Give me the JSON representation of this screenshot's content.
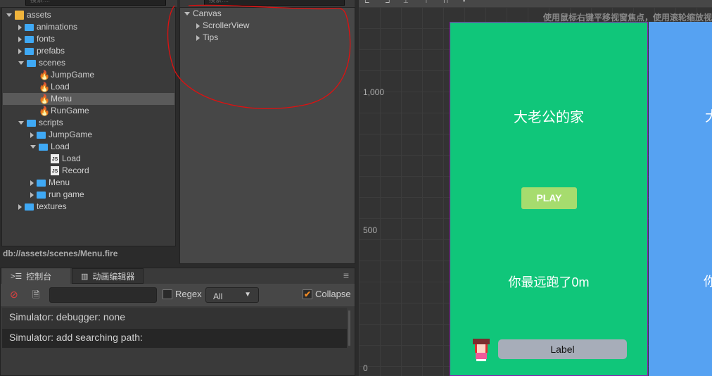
{
  "assets": {
    "search_placeholder": "搜索....",
    "items": [
      {
        "label": "assets",
        "type": "root",
        "indent": 0,
        "open": true
      },
      {
        "label": "animations",
        "type": "folder",
        "indent": 1,
        "open": false
      },
      {
        "label": "fonts",
        "type": "folder",
        "indent": 1,
        "open": false
      },
      {
        "label": "prefabs",
        "type": "folder",
        "indent": 1,
        "open": false
      },
      {
        "label": "scenes",
        "type": "folder",
        "indent": 1,
        "open": true
      },
      {
        "label": "JumpGame",
        "type": "fire",
        "indent": 2
      },
      {
        "label": "Load",
        "type": "fire",
        "indent": 2
      },
      {
        "label": "Menu",
        "type": "fire",
        "indent": 2,
        "selected": true
      },
      {
        "label": "RunGame",
        "type": "fire",
        "indent": 2
      },
      {
        "label": "scripts",
        "type": "folder",
        "indent": 1,
        "open": true
      },
      {
        "label": "JumpGame",
        "type": "folder",
        "indent": 2,
        "open": false
      },
      {
        "label": "Load",
        "type": "folder",
        "indent": 2,
        "open": true
      },
      {
        "label": "Load",
        "type": "js",
        "indent": 3
      },
      {
        "label": "Record",
        "type": "js",
        "indent": 3
      },
      {
        "label": "Menu",
        "type": "folder",
        "indent": 2,
        "open": false
      },
      {
        "label": "run game",
        "type": "folder",
        "indent": 2,
        "open": false
      },
      {
        "label": "textures",
        "type": "folder",
        "indent": 1,
        "open": false
      }
    ],
    "path": "db://assets/scenes/Menu.fire"
  },
  "hierarchy": {
    "search_placeholder": "搜索....",
    "items": [
      {
        "label": "Canvas",
        "indent": 0,
        "open": true
      },
      {
        "label": "ScrollerView",
        "indent": 1,
        "open": false
      },
      {
        "label": "Tips",
        "indent": 1,
        "open": false
      }
    ]
  },
  "console": {
    "tabs": [
      {
        "label": "控制台",
        "icon": "console-icon"
      },
      {
        "label": "动画编辑器",
        "icon": "animation-icon"
      }
    ],
    "regex_label": "Regex",
    "filter": "All",
    "collapse_label": "Collapse",
    "collapse_checked": true,
    "logs": [
      "Simulator: debugger: none",
      "Simulator: add searching path:"
    ]
  },
  "scene": {
    "hint": "使用鼠标右键平移视窗焦点，使用滚轮缩放视图",
    "ruler": [
      "1,000",
      "500",
      "0"
    ],
    "title": "大老公的家",
    "play": "PLAY",
    "distance": "你最远跑了0m",
    "label": "Label",
    "colors": {
      "green": "#10c67a",
      "blue": "#56a2f2",
      "play": "#a6dc6e",
      "annotation": "#e01010"
    }
  }
}
